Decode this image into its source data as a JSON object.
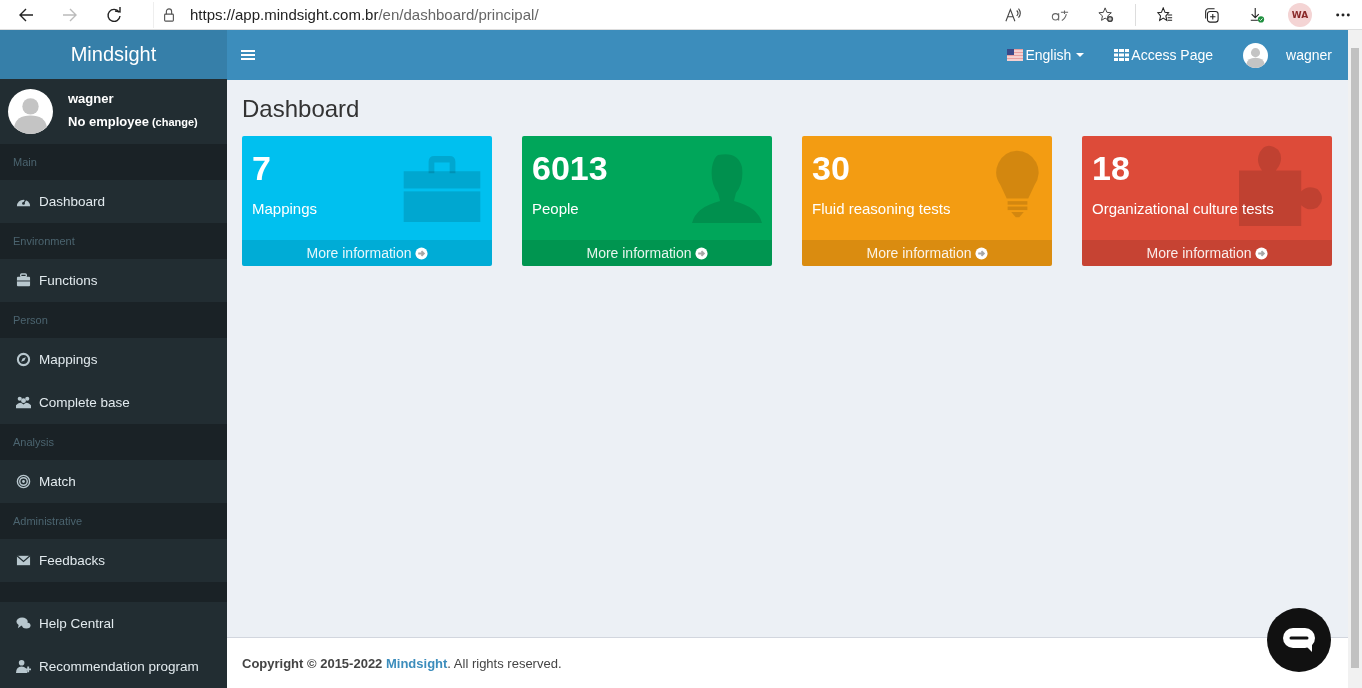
{
  "browser": {
    "url_host": "https://app.mindsight.com.br",
    "url_path": "/en/dashboard/principal/",
    "profile": "WA"
  },
  "sidebar": {
    "logo": "Mindsight",
    "user": {
      "name": "wagner",
      "employee": "No employee",
      "change": "(change)"
    },
    "sections": [
      {
        "header": "Main",
        "items": [
          {
            "label": "Dashboard",
            "kind": "dashboard"
          }
        ]
      },
      {
        "header": "Environment",
        "items": [
          {
            "label": "Functions",
            "kind": "briefcase"
          }
        ]
      },
      {
        "header": "Person",
        "items": [
          {
            "label": "Mappings",
            "kind": "compass"
          },
          {
            "label": "Complete base",
            "kind": "users"
          }
        ]
      },
      {
        "header": "Analysis",
        "items": [
          {
            "label": "Match",
            "kind": "target"
          }
        ]
      },
      {
        "header": "Administrative",
        "items": [
          {
            "label": "Feedbacks",
            "kind": "envelope"
          }
        ]
      },
      {
        "items": [
          {
            "label": "Help Central",
            "kind": "chat"
          },
          {
            "label": "Recommendation program",
            "kind": "user-plus"
          }
        ]
      }
    ]
  },
  "header": {
    "language": "English",
    "access": "Access Page",
    "user": "wagner"
  },
  "page_title": "Dashboard",
  "cards": [
    {
      "count": "7",
      "label": "Mappings",
      "link": "More information",
      "color": "#00c0ef",
      "kind": "briefcase"
    },
    {
      "count": "6013",
      "label": "People",
      "link": "More information",
      "color": "#00a65a",
      "kind": "user"
    },
    {
      "count": "30",
      "label": "Fluid reasoning tests",
      "link": "More information",
      "color": "#f39c12",
      "kind": "bulb"
    },
    {
      "count": "18",
      "label": "Organizational culture tests",
      "link": "More information",
      "color": "#dd4b39",
      "kind": "puzzle"
    }
  ],
  "footer": {
    "prefix": "Copyright © 2015-2022",
    "link": "Mindsight",
    "suffix": ". All rights reserved."
  }
}
